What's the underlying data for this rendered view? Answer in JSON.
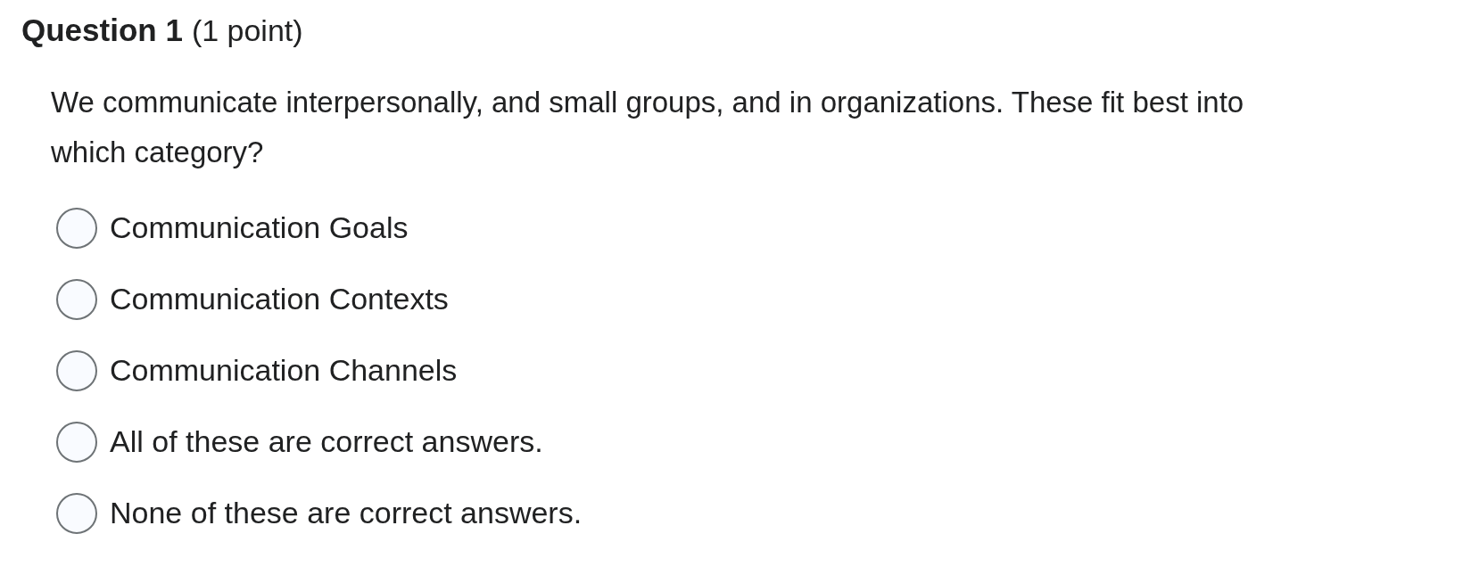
{
  "question": {
    "title": "Question 1",
    "points": "(1 point)",
    "prompt": "We communicate interpersonally, and small groups, and in organizations. These fit best into which category?"
  },
  "options": [
    {
      "label": "Communication Goals",
      "selected": false
    },
    {
      "label": "Communication Contexts",
      "selected": false
    },
    {
      "label": "Communication Channels",
      "selected": false
    },
    {
      "label": "All of these are correct answers.",
      "selected": false
    },
    {
      "label": "None of these are correct answers.",
      "selected": false
    }
  ]
}
